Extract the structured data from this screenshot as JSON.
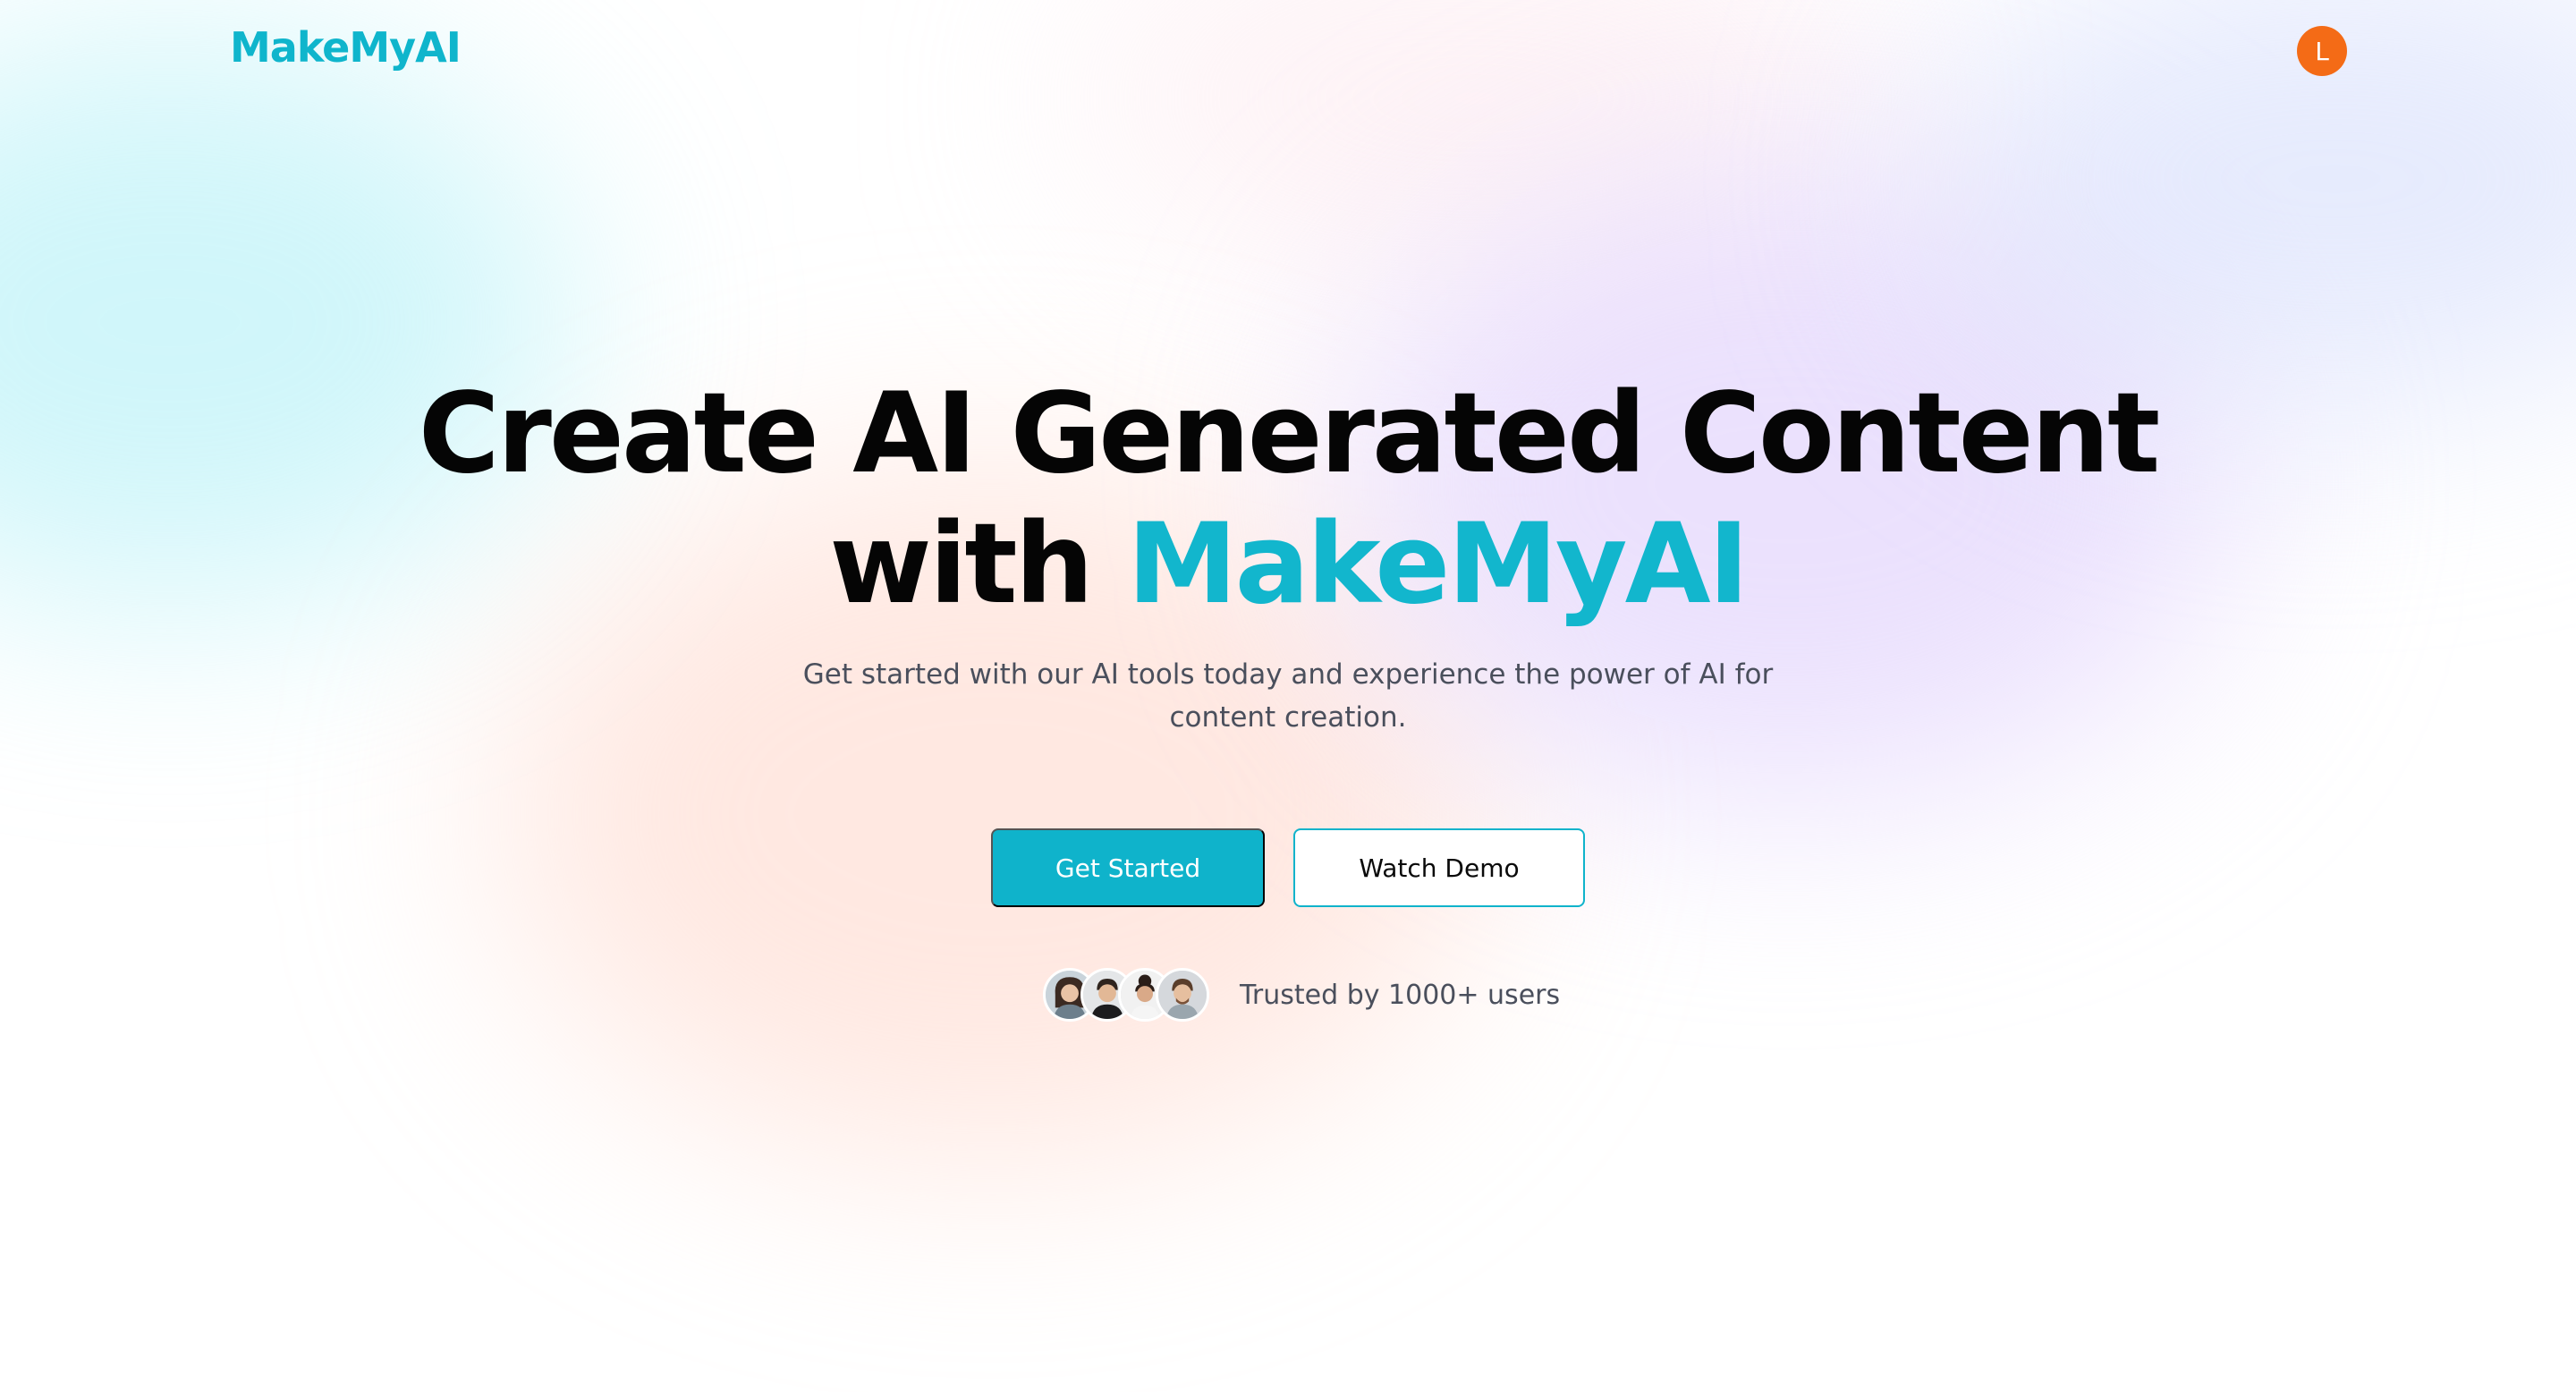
{
  "header": {
    "logo_text": "MakeMyAI",
    "user_avatar_initial": "L",
    "user_avatar_color": "#f46b16"
  },
  "hero": {
    "title_line1": "Create AI Generated Content",
    "title_line2_prefix": "with",
    "title_line2_brand": "MakeMyAI",
    "subtitle_line1": "Get started with our AI tools today and experience the power of AI for",
    "subtitle_line2": "content creation."
  },
  "actions": {
    "primary_label": "Get Started",
    "secondary_label": "Watch Demo"
  },
  "social_proof": {
    "avatars": [
      "user-photo-1",
      "user-photo-2",
      "user-photo-3",
      "user-photo-4"
    ],
    "text": "Trusted by 1000+ users"
  },
  "colors": {
    "brand": "#0fb5cc",
    "heading": "#050505",
    "body_text": "#4a4f5c",
    "avatar": "#f46b16"
  }
}
